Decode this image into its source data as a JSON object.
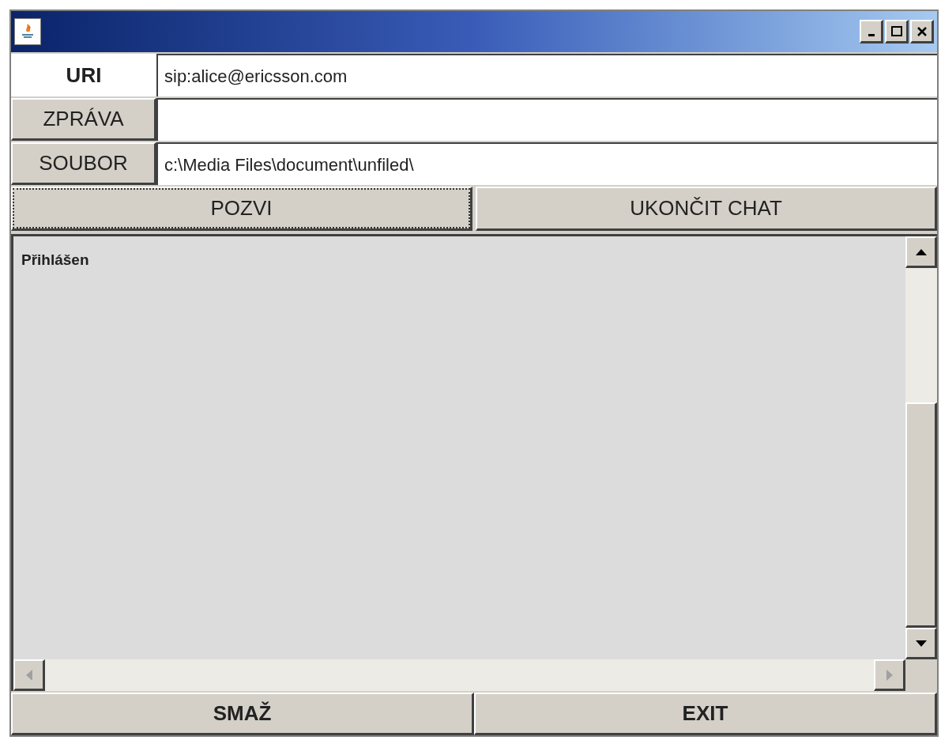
{
  "form_rows": [
    {
      "kind": "label",
      "label": "URI",
      "value": "sip:alice@ericsson.com"
    },
    {
      "kind": "button",
      "label": "ZPRÁVA"
    },
    {
      "kind": "button",
      "label": "SOUBOR",
      "value": "c:\\Media Files\\document\\unfiled\\"
    }
  ],
  "action_buttons": [
    {
      "label": "POZVI",
      "focused": true
    },
    {
      "label": "UKONČIT CHAT",
      "focused": false
    }
  ],
  "log": {
    "text": "Přihlášen"
  },
  "bottom_buttons": [
    {
      "label": "SMAŽ"
    },
    {
      "label": "EXIT"
    }
  ]
}
